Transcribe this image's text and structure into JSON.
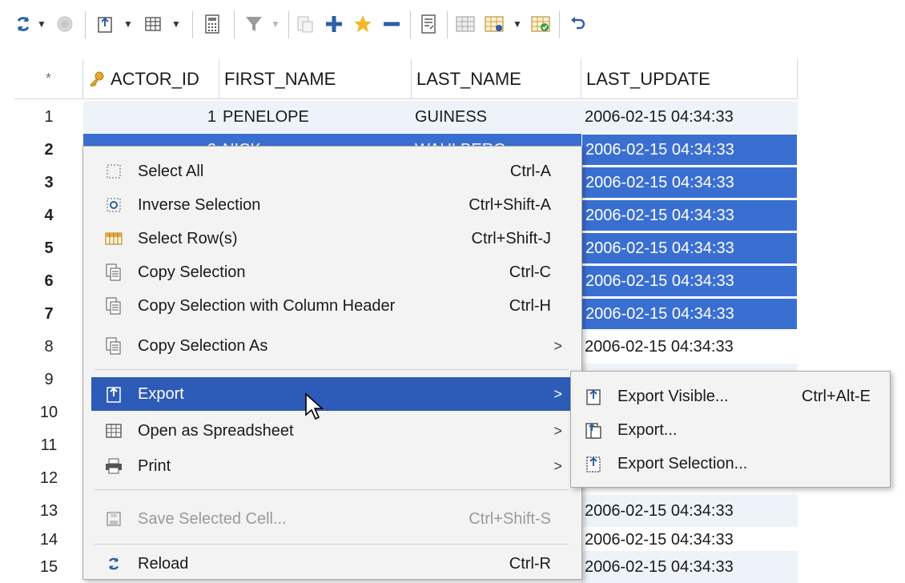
{
  "toolbar": {
    "buttons": [
      "reload-icon",
      "stop-icon",
      "export-icon",
      "spreadsheet-icon",
      "calculator-icon",
      "filter-icon",
      "paste-icon",
      "add-row-icon",
      "star-icon",
      "delete-row-icon",
      "script-icon",
      "grid-settings-icon",
      "grid-options-icon",
      "refresh-grid-icon",
      "undo-icon"
    ]
  },
  "grid": {
    "corner": "*",
    "columns": [
      "ACTOR_ID",
      "FIRST_NAME",
      "LAST_NAME",
      "LAST_UPDATE"
    ],
    "rows": [
      {
        "num": "1",
        "id": "1",
        "first": "PENELOPE",
        "last": "GUINESS",
        "updated": "2006-02-15 04:34:33"
      },
      {
        "num": "2",
        "id": "2",
        "first": "NICK",
        "last": "WAHLBERG",
        "updated": "2006-02-15 04:34:33"
      },
      {
        "num": "3",
        "id": "",
        "first": "",
        "last": "",
        "updated": "2006-02-15 04:34:33"
      },
      {
        "num": "4",
        "id": "",
        "first": "",
        "last": "",
        "updated": "2006-02-15 04:34:33"
      },
      {
        "num": "5",
        "id": "",
        "first": "",
        "last": "",
        "updated": "2006-02-15 04:34:33"
      },
      {
        "num": "6",
        "id": "",
        "first": "",
        "last": "",
        "updated": "2006-02-15 04:34:33"
      },
      {
        "num": "7",
        "id": "",
        "first": "",
        "last": "",
        "updated": "2006-02-15 04:34:33"
      },
      {
        "num": "8",
        "id": "",
        "first": "",
        "last": "",
        "updated": "2006-02-15 04:34:33"
      },
      {
        "num": "9",
        "id": "",
        "first": "",
        "last": "",
        "updated": ""
      },
      {
        "num": "10",
        "id": "",
        "first": "",
        "last": "",
        "updated": ""
      },
      {
        "num": "11",
        "id": "",
        "first": "",
        "last": "",
        "updated": ""
      },
      {
        "num": "12",
        "id": "",
        "first": "",
        "last": "",
        "updated": ""
      },
      {
        "num": "13",
        "id": "",
        "first": "",
        "last": "",
        "updated": "2006-02-15 04:34:33"
      },
      {
        "num": "14",
        "id": "",
        "first": "",
        "last": "",
        "updated": "2006-02-15 04:34:33"
      },
      {
        "num": "15",
        "id": "",
        "first": "",
        "last": "",
        "updated": "2006-02-15 04:34:33"
      }
    ]
  },
  "menu": {
    "select_all": {
      "label": "Select All",
      "shortcut": "Ctrl-A"
    },
    "inverse": {
      "label": "Inverse Selection",
      "shortcut": "Ctrl+Shift-A"
    },
    "select_rows": {
      "label": "Select Row(s)",
      "shortcut": "Ctrl+Shift-J"
    },
    "copy": {
      "label": "Copy Selection",
      "shortcut": "Ctrl-C"
    },
    "copy_header": {
      "label": "Copy Selection with Column Header",
      "shortcut": "Ctrl-H"
    },
    "copy_as": {
      "label": "Copy Selection As"
    },
    "export": {
      "label": "Export"
    },
    "spreadsheet": {
      "label": "Open as Spreadsheet"
    },
    "print": {
      "label": "Print"
    },
    "save_cell": {
      "label": "Save Selected Cell...",
      "shortcut": "Ctrl+Shift-S"
    },
    "reload": {
      "label": "Reload",
      "shortcut": "Ctrl-R"
    }
  },
  "submenu": {
    "export_visible": {
      "label": "Export Visible...",
      "shortcut": "Ctrl+Alt-E"
    },
    "export": {
      "label": "Export..."
    },
    "export_selection": {
      "label": "Export Selection..."
    }
  },
  "colors": {
    "selection": "#3a6fd2",
    "menu_highlight": "#2d5bb8",
    "alt_row": "#eef3f9"
  }
}
